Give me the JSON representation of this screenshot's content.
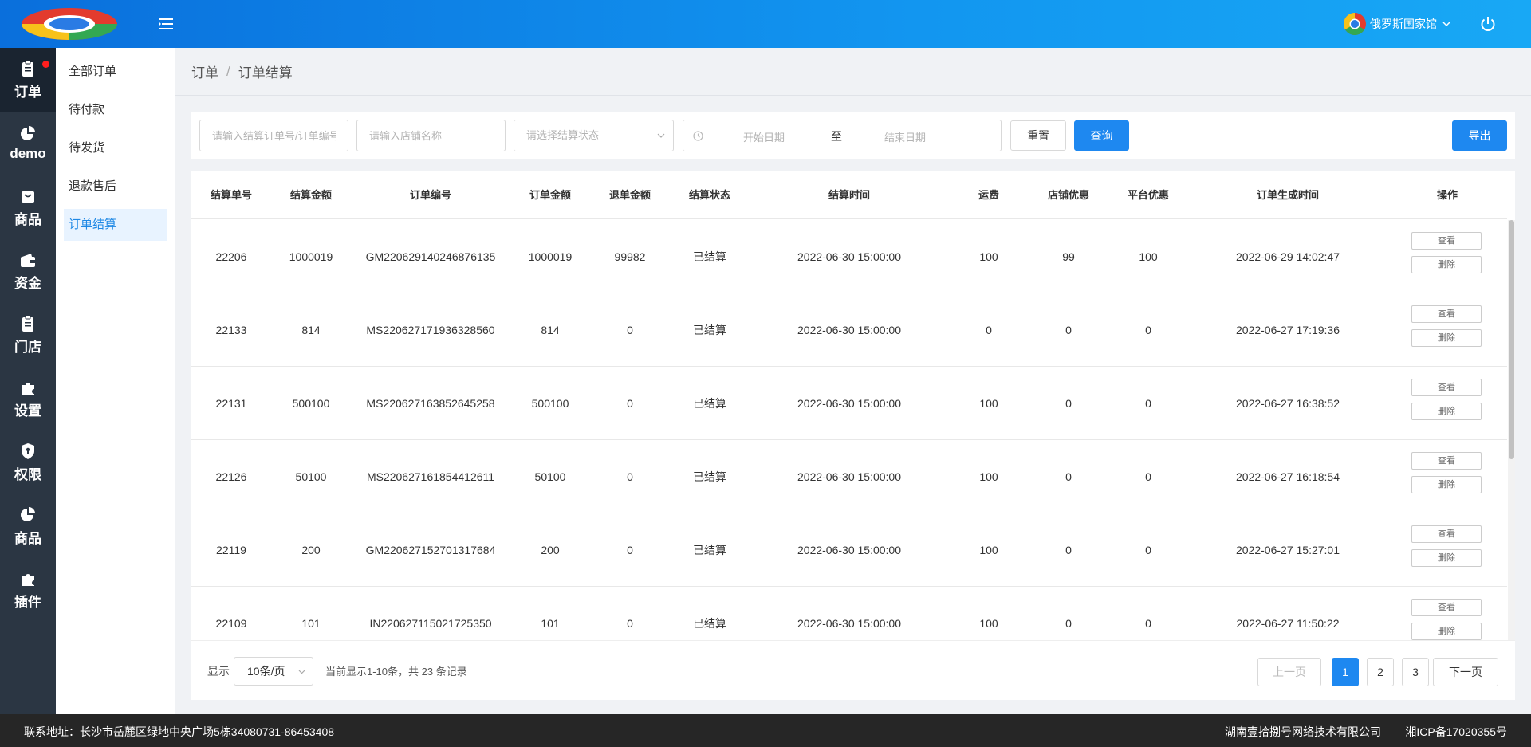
{
  "header": {
    "user_name": "俄罗斯国家馆"
  },
  "nav": {
    "items": [
      {
        "label": "订单",
        "icon": "clipboard-icon"
      },
      {
        "label": "demo",
        "icon": "pie-chart-icon"
      },
      {
        "label": "商品",
        "icon": "bag-icon"
      },
      {
        "label": "资金",
        "icon": "wallet-icon"
      },
      {
        "label": "门店",
        "icon": "clipboard-icon"
      },
      {
        "label": "设置",
        "icon": "puzzle-icon"
      },
      {
        "label": "权限",
        "icon": "shield-icon"
      },
      {
        "label": "商品",
        "icon": "pie-chart-icon"
      },
      {
        "label": "插件",
        "icon": "puzzle-icon"
      }
    ]
  },
  "submenu": {
    "items": [
      "全部订单",
      "待付款",
      "待发货",
      "退款售后",
      "订单结算"
    ]
  },
  "breadcrumb": {
    "parent": "订单",
    "separator": "/",
    "current": "订单结算"
  },
  "filter": {
    "order_placeholder": "请输入结算订单号/订单编号",
    "shop_placeholder": "请输入店铺名称",
    "status_placeholder": "请选择结算状态",
    "start_date_placeholder": "开始日期",
    "date_separator": "至",
    "end_date_placeholder": "结束日期",
    "reset_label": "重置",
    "query_label": "查询",
    "export_label": "导出"
  },
  "table": {
    "columns": [
      "结算单号",
      "结算金额",
      "订单编号",
      "订单金额",
      "退单金额",
      "结算状态",
      "结算时间",
      "运费",
      "店铺优惠",
      "平台优惠",
      "订单生成时间",
      "操作"
    ],
    "view_label": "查看",
    "delete_label": "删除",
    "rows": [
      [
        "22206",
        "1000019",
        "GM220629140246876135",
        "1000019",
        "99982",
        "已结算",
        "2022-06-30 15:00:00",
        "100",
        "99",
        "100",
        "2022-06-29 14:02:47"
      ],
      [
        "22133",
        "814",
        "MS220627171936328560",
        "814",
        "0",
        "已结算",
        "2022-06-30 15:00:00",
        "0",
        "0",
        "0",
        "2022-06-27 17:19:36"
      ],
      [
        "22131",
        "500100",
        "MS220627163852645258",
        "500100",
        "0",
        "已结算",
        "2022-06-30 15:00:00",
        "100",
        "0",
        "0",
        "2022-06-27 16:38:52"
      ],
      [
        "22126",
        "50100",
        "MS220627161854412611",
        "50100",
        "0",
        "已结算",
        "2022-06-30 15:00:00",
        "100",
        "0",
        "0",
        "2022-06-27 16:18:54"
      ],
      [
        "22119",
        "200",
        "GM220627152701317684",
        "200",
        "0",
        "已结算",
        "2022-06-30 15:00:00",
        "100",
        "0",
        "0",
        "2022-06-27 15:27:01"
      ],
      [
        "22109",
        "101",
        "IN220627115021725350",
        "101",
        "0",
        "已结算",
        "2022-06-30 15:00:00",
        "100",
        "0",
        "0",
        "2022-06-27 11:50:22"
      ]
    ]
  },
  "pagination": {
    "show_label": "显示",
    "page_size": "10条/页",
    "info": "当前显示1-10条，共 23 条记录",
    "prev_label": "上一页",
    "next_label": "下一页",
    "pages": [
      "1",
      "2",
      "3"
    ],
    "current_page": "1"
  },
  "footer": {
    "address": "联系地址：长沙市岳麓区绿地中央广场5栋34080731-86453408",
    "company": "湖南壹拾捌号网络技术有限公司",
    "icp": "湘ICP备17020355号"
  },
  "colors": {
    "header_gradient_start": "#0a6fdc",
    "header_gradient_end": "#18a8f5",
    "primary": "#1e88f0",
    "nav_bg": "#2b3643",
    "footer_bg": "#262626",
    "badge": "#ff1e1e"
  }
}
